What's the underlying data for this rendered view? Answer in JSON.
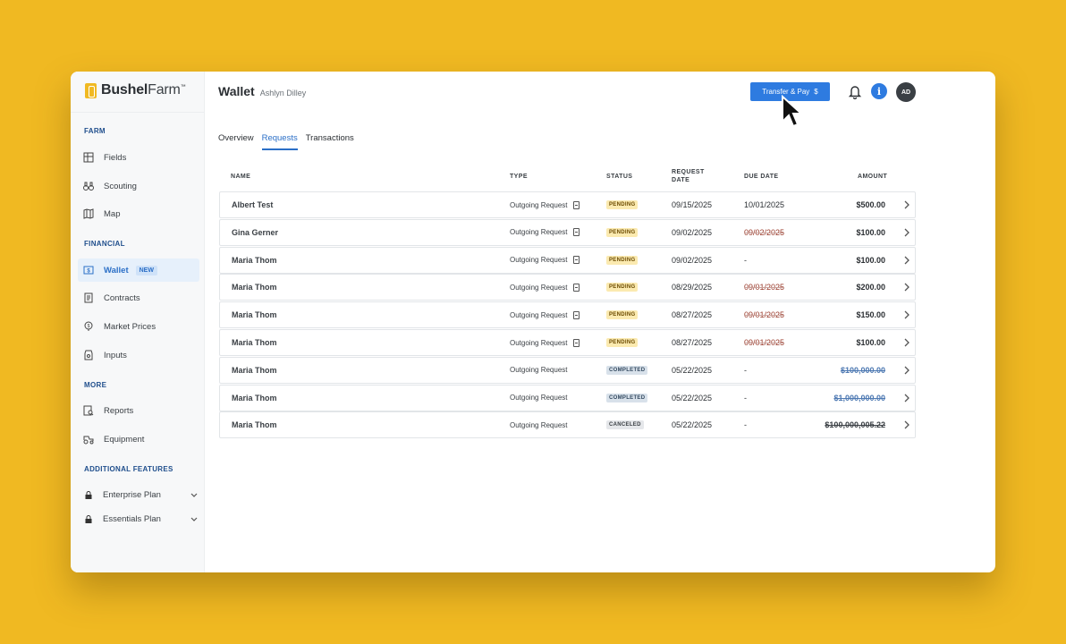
{
  "brand": {
    "name_bold": "Bushel",
    "name_regular": "Farm",
    "trademark": "™"
  },
  "colors": {
    "accent": "#2e7be0",
    "background": "#f0b922",
    "pending": "#fbeab0",
    "completed": "#d8e1ea",
    "overdue": "#9a3a2a"
  },
  "sidebar": {
    "sections": [
      {
        "label": "FARM",
        "items": [
          {
            "label": "Fields",
            "icon": "fields-icon"
          },
          {
            "label": "Scouting",
            "icon": "binoculars-icon"
          },
          {
            "label": "Map",
            "icon": "map-icon"
          }
        ]
      },
      {
        "label": "FINANCIAL",
        "items": [
          {
            "label": "Wallet",
            "icon": "wallet-icon",
            "badge": "NEW",
            "active": true
          },
          {
            "label": "Contracts",
            "icon": "contracts-icon"
          },
          {
            "label": "Market Prices",
            "icon": "market-prices-icon"
          },
          {
            "label": "Inputs",
            "icon": "inputs-icon"
          }
        ]
      },
      {
        "label": "MORE",
        "items": [
          {
            "label": "Reports",
            "icon": "reports-icon"
          },
          {
            "label": "Equipment",
            "icon": "tractor-icon"
          }
        ]
      },
      {
        "label": "ADDITIONAL FEATURES",
        "items": [
          {
            "label": "Enterprise Plan",
            "icon": "lock-icon"
          },
          {
            "label": "Essentials Plan",
            "icon": "lock-icon"
          }
        ]
      }
    ]
  },
  "header": {
    "title": "Wallet",
    "subtitle": "Ashlyn Dilley",
    "transfer_button": "Transfer & Pay",
    "transfer_icon": "$",
    "info_icon": "i",
    "avatar_initials": "AD"
  },
  "tabs": [
    {
      "label": "Overview",
      "active": false
    },
    {
      "label": "Requests",
      "active": true
    },
    {
      "label": "Transactions",
      "active": false
    }
  ],
  "table": {
    "columns": {
      "name": "NAME",
      "type": "TYPE",
      "status": "STATUS",
      "request_date_1": "REQUEST",
      "request_date_2": "DATE",
      "due_date": "DUE DATE",
      "amount": "AMOUNT"
    },
    "rows": [
      {
        "name": "Albert Test",
        "type": "Outgoing Request",
        "doc": true,
        "status": "PENDING",
        "status_kind": "pending",
        "request_date": "09/15/2025",
        "due_date": "10/01/2025",
        "due_overdue": false,
        "amount": "$500.00",
        "amount_kind": "normal"
      },
      {
        "name": "Gina Gerner",
        "type": "Outgoing Request",
        "doc": true,
        "status": "PENDING",
        "status_kind": "pending",
        "request_date": "09/02/2025",
        "due_date": "09/02/2025",
        "due_overdue": true,
        "amount": "$100.00",
        "amount_kind": "normal"
      },
      {
        "name": "Maria Thom",
        "type": "Outgoing Request",
        "doc": true,
        "status": "PENDING",
        "status_kind": "pending",
        "request_date": "09/02/2025",
        "due_date": "-",
        "due_overdue": false,
        "amount": "$100.00",
        "amount_kind": "normal"
      },
      {
        "name": "Maria Thom",
        "type": "Outgoing Request",
        "doc": true,
        "status": "PENDING",
        "status_kind": "pending",
        "request_date": "08/29/2025",
        "due_date": "09/01/2025",
        "due_overdue": true,
        "amount": "$200.00",
        "amount_kind": "normal"
      },
      {
        "name": "Maria Thom",
        "type": "Outgoing Request",
        "doc": true,
        "status": "PENDING",
        "status_kind": "pending",
        "request_date": "08/27/2025",
        "due_date": "09/01/2025",
        "due_overdue": true,
        "amount": "$150.00",
        "amount_kind": "normal"
      },
      {
        "name": "Maria Thom",
        "type": "Outgoing Request",
        "doc": true,
        "status": "PENDING",
        "status_kind": "pending",
        "request_date": "08/27/2025",
        "due_date": "09/01/2025",
        "due_overdue": true,
        "amount": "$100.00",
        "amount_kind": "normal"
      },
      {
        "name": "Maria Thom",
        "type": "Outgoing Request",
        "doc": false,
        "status": "COMPLETED",
        "status_kind": "completed",
        "request_date": "05/22/2025",
        "due_date": "-",
        "due_overdue": false,
        "amount": "$100,000.00",
        "amount_kind": "paid"
      },
      {
        "name": "Maria Thom",
        "type": "Outgoing Request",
        "doc": false,
        "status": "COMPLETED",
        "status_kind": "completed",
        "request_date": "05/22/2025",
        "due_date": "-",
        "due_overdue": false,
        "amount": "$1,000,000.00",
        "amount_kind": "paid"
      },
      {
        "name": "Maria Thom",
        "type": "Outgoing Request",
        "doc": false,
        "status": "CANCELED",
        "status_kind": "canceled",
        "request_date": "05/22/2025",
        "due_date": "-",
        "due_overdue": false,
        "amount": "$100,000,005.22",
        "amount_kind": "canceled"
      }
    ]
  }
}
